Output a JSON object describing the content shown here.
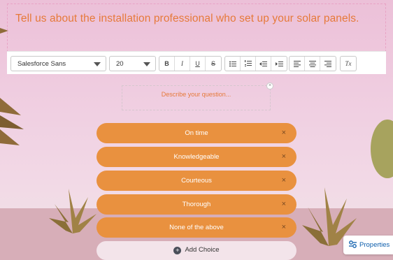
{
  "question": {
    "text": "Tell us about the installation professional who set up your solar panels."
  },
  "toolbar": {
    "font_family": "Salesforce Sans",
    "font_size": "20",
    "bold_label": "B",
    "italic_label": "I",
    "underline_label": "U",
    "strike_label": "S",
    "clear_format_label": "Tx"
  },
  "description": {
    "placeholder": "Describe your question...",
    "close_glyph": "×"
  },
  "choices": [
    {
      "label": "On time"
    },
    {
      "label": "Knowledgeable"
    },
    {
      "label": "Courteous"
    },
    {
      "label": "Thorough"
    },
    {
      "label": "None of the above"
    }
  ],
  "remove_glyph": "×",
  "add_choice": {
    "label": "Add Choice",
    "icon_glyph": "+"
  },
  "properties_button": {
    "label": "Properties"
  },
  "colors": {
    "accent_orange": "#e9913f",
    "question_text": "#e67a3a",
    "link_blue": "#0b5cab"
  }
}
